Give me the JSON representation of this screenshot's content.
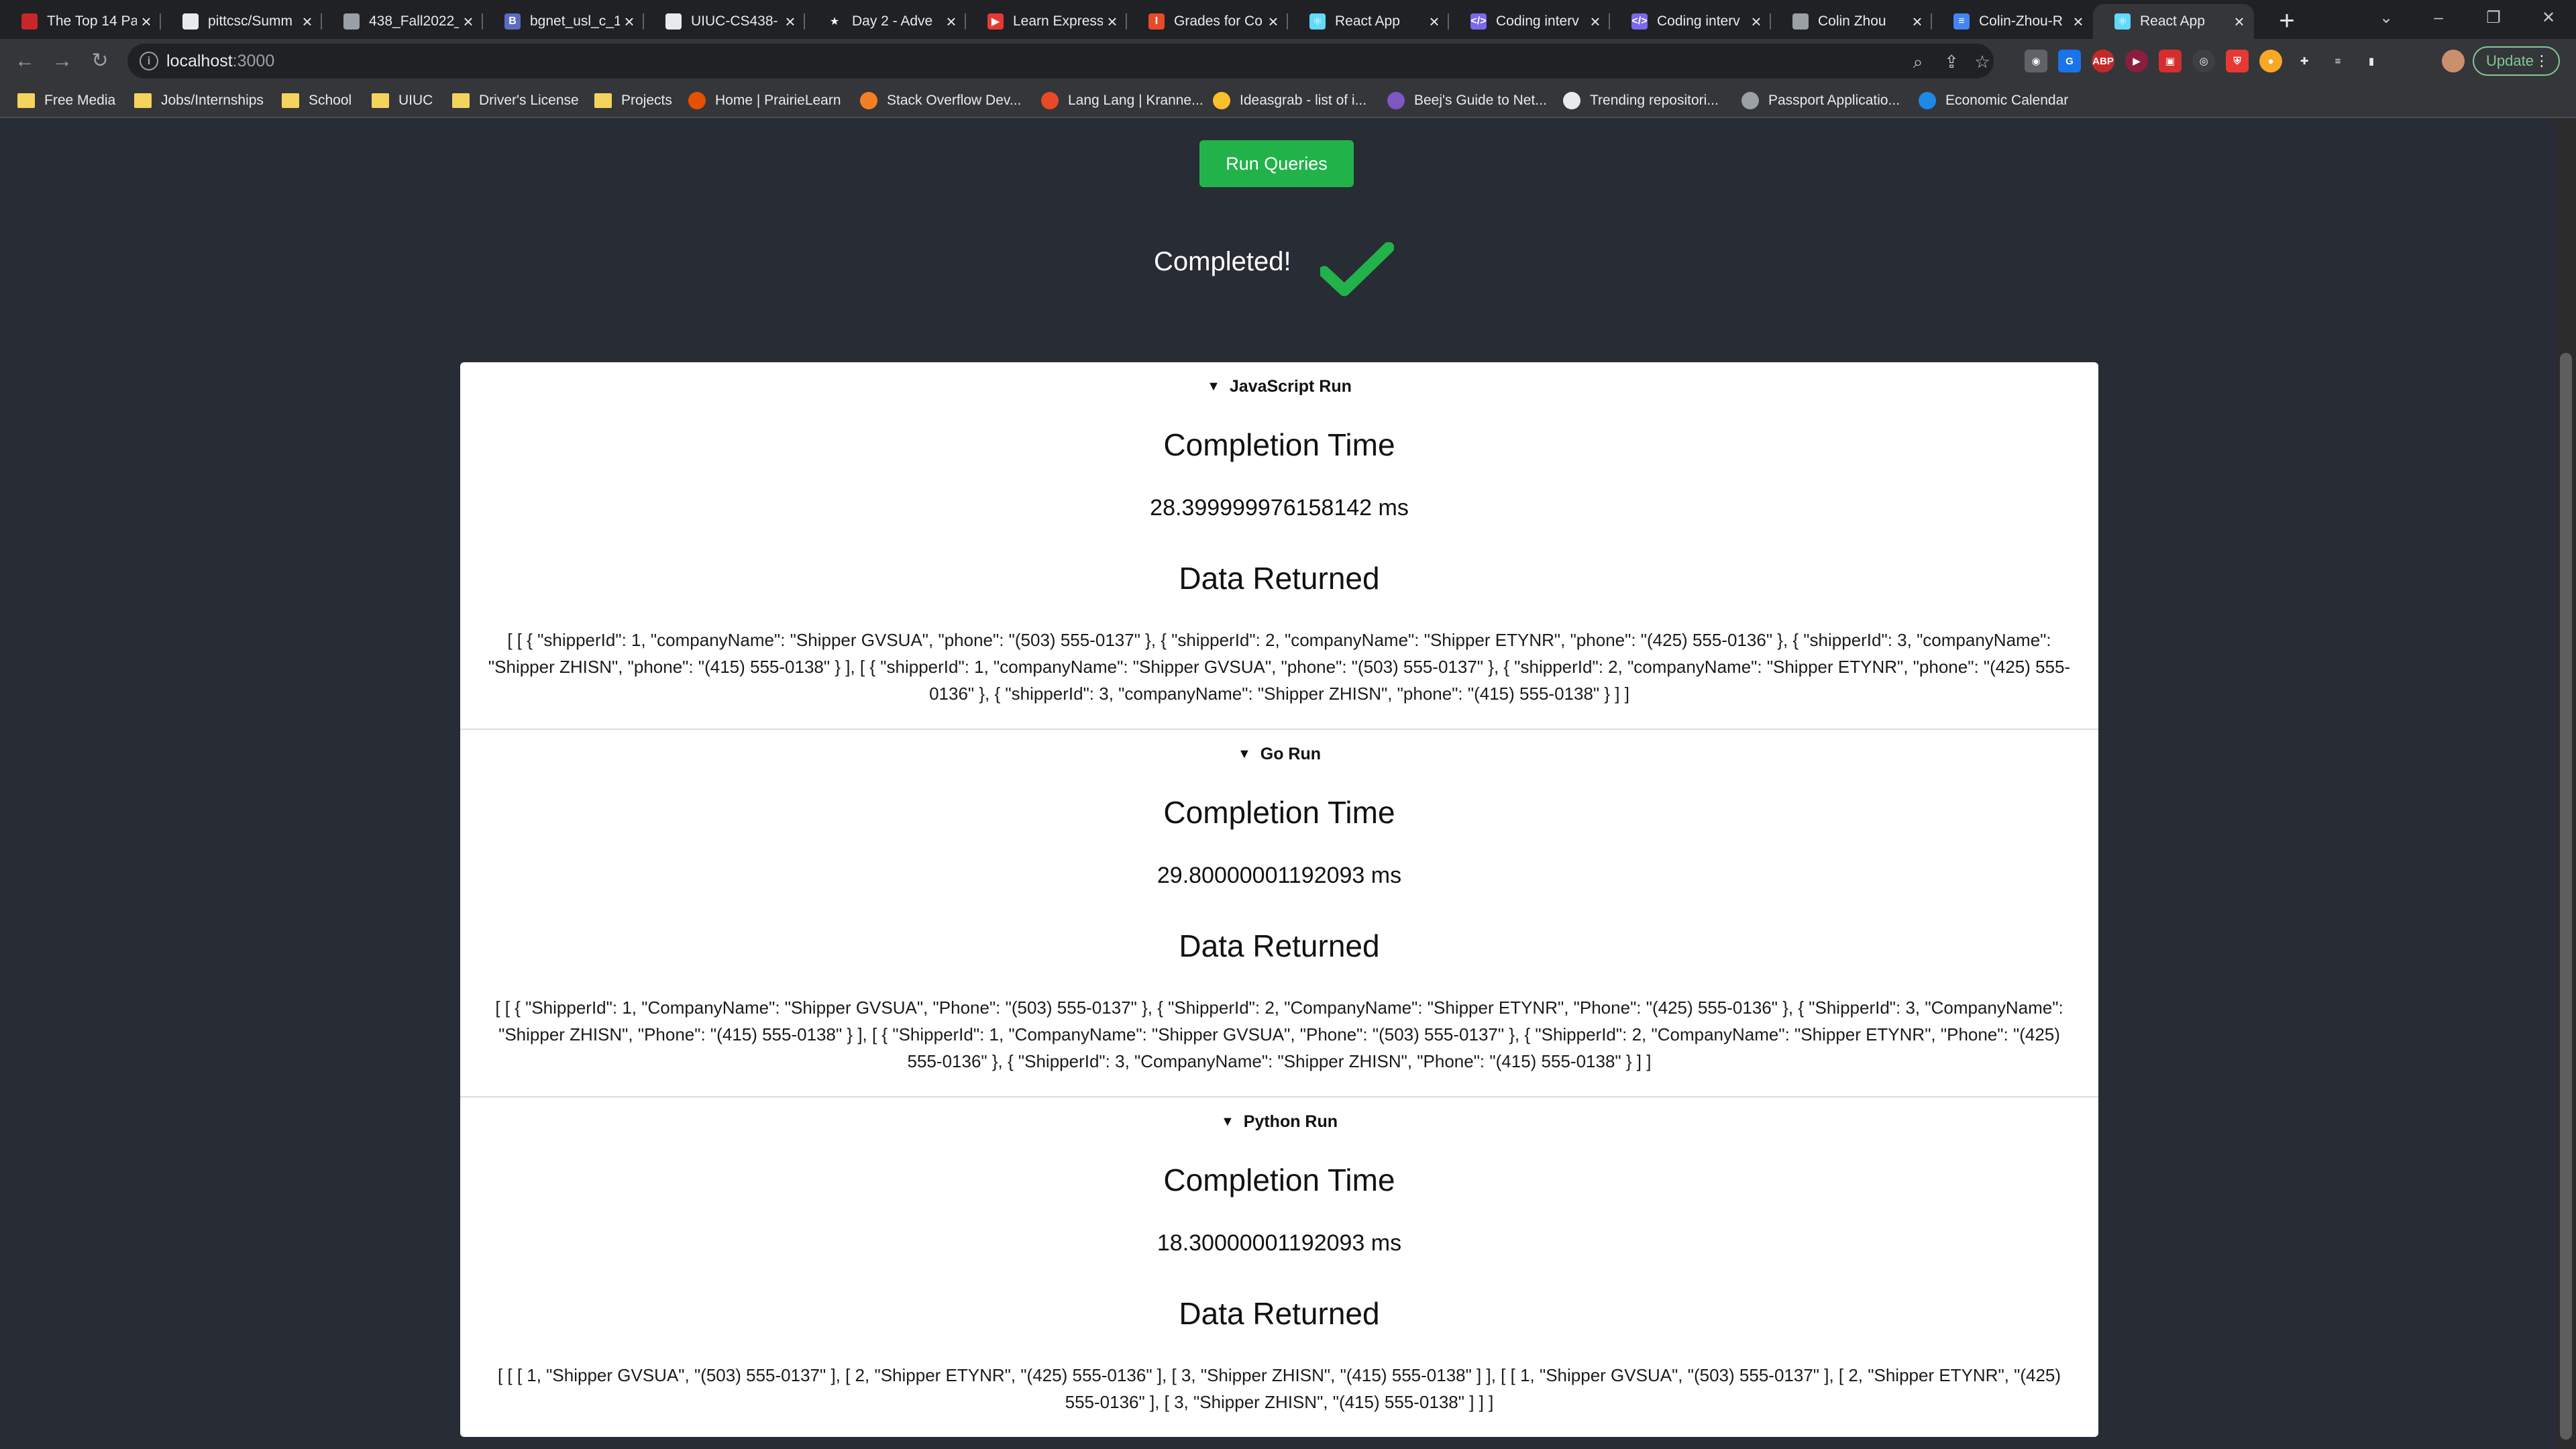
{
  "browser": {
    "tabs": [
      {
        "label": "The Top 14 Pa",
        "color": "#c62828",
        "glyph": ""
      },
      {
        "label": "pittcsc/Summ",
        "color": "#e8eaed",
        "glyph": ""
      },
      {
        "label": "438_Fall2022_",
        "color": "#9aa0a6",
        "glyph": ""
      },
      {
        "label": "bgnet_usl_c_1",
        "color": "#5c6bc0",
        "glyph": "B"
      },
      {
        "label": "UIUC-CS438-",
        "color": "#e8eaed",
        "glyph": ""
      },
      {
        "label": "Day 2 - Adve",
        "color": "#202124",
        "glyph": "★"
      },
      {
        "label": "Learn Express",
        "color": "#e53935",
        "glyph": "▶"
      },
      {
        "label": "Grades for Co",
        "color": "#e84a27",
        "glyph": "I"
      },
      {
        "label": "React App",
        "color": "#61dafb",
        "glyph": "⚛"
      },
      {
        "label": "Coding interv",
        "color": "#7b68ee",
        "glyph": "</>"
      },
      {
        "label": "Coding interv",
        "color": "#7b68ee",
        "glyph": "</>"
      },
      {
        "label": "Colin Zhou",
        "color": "#9aa0a6",
        "glyph": ""
      },
      {
        "label": "Colin-Zhou-R",
        "color": "#4285f4",
        "glyph": "≡"
      },
      {
        "label": "React App",
        "color": "#61dafb",
        "glyph": "⚛"
      }
    ],
    "url_host": "localhost",
    "url_port": ":3000",
    "update_label": "Update",
    "bookmarks": [
      {
        "label": "Free Media",
        "icon": "folder"
      },
      {
        "label": "Jobs/Internships",
        "icon": "folder"
      },
      {
        "label": "School",
        "icon": "folder"
      },
      {
        "label": "UIUC",
        "icon": "folder"
      },
      {
        "label": "Driver's License",
        "icon": "folder"
      },
      {
        "label": "Projects",
        "icon": "folder"
      },
      {
        "label": "Home | PrairieLearn",
        "icon": "prairielearn-icon"
      },
      {
        "label": "Stack Overflow Dev...",
        "icon": "stackoverflow-icon"
      },
      {
        "label": "Lang Lang | Kranne...",
        "icon": "illinois-icon"
      },
      {
        "label": "Ideasgrab - list of i...",
        "icon": "lightbulb-icon"
      },
      {
        "label": "Beej's Guide to Net...",
        "icon": "beej-icon"
      },
      {
        "label": "Trending repositori...",
        "icon": "github-icon"
      },
      {
        "label": "Passport Applicatio...",
        "icon": "passport-icon"
      },
      {
        "label": "Economic Calendar",
        "icon": "calendar-icon"
      }
    ]
  },
  "app": {
    "run_button_label": "Run Queries",
    "status_text": "Completed!",
    "sections": [
      {
        "title": "JavaScript Run",
        "time_heading": "Completion Time",
        "time_value": "28.399999976158142 ms",
        "data_heading": "Data Returned",
        "data_value": "[ [ { \"shipperId\": 1, \"companyName\": \"Shipper GVSUA\", \"phone\": \"(503) 555-0137\" }, { \"shipperId\": 2, \"companyName\": \"Shipper ETYNR\", \"phone\": \"(425) 555-0136\" }, { \"shipperId\": 3, \"companyName\": \"Shipper ZHISN\", \"phone\": \"(415) 555-0138\" } ], [ { \"shipperId\": 1, \"companyName\": \"Shipper GVSUA\", \"phone\": \"(503) 555-0137\" }, { \"shipperId\": 2, \"companyName\": \"Shipper ETYNR\", \"phone\": \"(425) 555-0136\" }, { \"shipperId\": 3, \"companyName\": \"Shipper ZHISN\", \"phone\": \"(415) 555-0138\" } ] ]"
      },
      {
        "title": "Go Run",
        "time_heading": "Completion Time",
        "time_value": "29.80000001192093 ms",
        "data_heading": "Data Returned",
        "data_value": "[ [ { \"ShipperId\": 1, \"CompanyName\": \"Shipper GVSUA\", \"Phone\": \"(503) 555-0137\" }, { \"ShipperId\": 2, \"CompanyName\": \"Shipper ETYNR\", \"Phone\": \"(425) 555-0136\" }, { \"ShipperId\": 3, \"CompanyName\": \"Shipper ZHISN\", \"Phone\": \"(415) 555-0138\" } ], [ { \"ShipperId\": 1, \"CompanyName\": \"Shipper GVSUA\", \"Phone\": \"(503) 555-0137\" }, { \"ShipperId\": 2, \"CompanyName\": \"Shipper ETYNR\", \"Phone\": \"(425) 555-0136\" }, { \"ShipperId\": 3, \"CompanyName\": \"Shipper ZHISN\", \"Phone\": \"(415) 555-0138\" } ] ]"
      },
      {
        "title": "Python Run",
        "time_heading": "Completion Time",
        "time_value": "18.30000001192093 ms",
        "data_heading": "Data Returned",
        "data_value": "[ [ [ 1, \"Shipper GVSUA\", \"(503) 555-0137\" ], [ 2, \"Shipper ETYNR\", \"(425) 555-0136\" ], [ 3, \"Shipper ZHISN\", \"(415) 555-0138\" ] ], [ [ 1, \"Shipper GVSUA\", \"(503) 555-0137\" ], [ 2, \"Shipper ETYNR\", \"(425) 555-0136\" ], [ 3, \"Shipper ZHISN\", \"(415) 555-0138\" ] ] ]"
      }
    ]
  },
  "colors": {
    "page_bg": "#282c34",
    "button_green": "#21b34a",
    "check_green": "#21b34a",
    "card_bg": "#ffffff"
  }
}
